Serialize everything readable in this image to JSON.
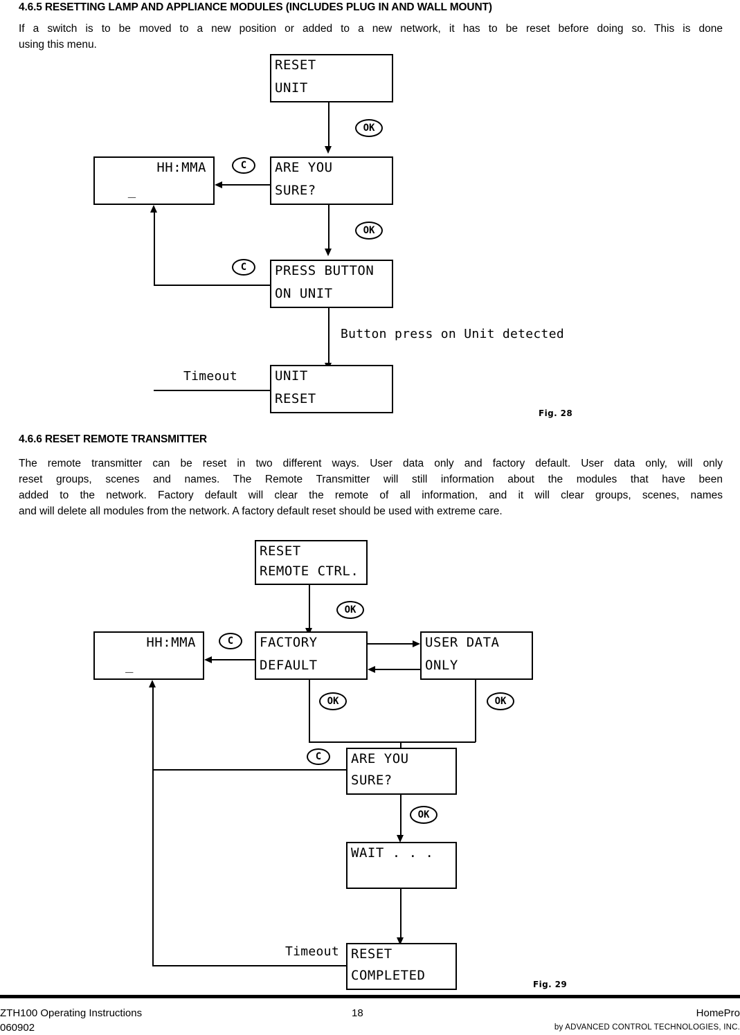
{
  "document": {
    "page_number": "18",
    "footer_left_line1": "ZTH100 Operating Instructions",
    "footer_left_line2": "060902",
    "footer_right_brand": "HomePro",
    "footer_right_sub": "by ADVANCED CONTROL TECHNOLOGIES, INC."
  },
  "section_465": {
    "heading": "4.6.5 RESETTING LAMP AND APPLIANCE MODULES (INCLUDES PLUG IN AND WALL MOUNT)",
    "body_line1": "If a switch is to be moved to a new position or added to a new network, it has to be reset before doing so.  This is done",
    "body_line2": "using this menu."
  },
  "section_466": {
    "heading": "4.6.6  RESET  REMOTE  TRANSMITTER",
    "body_line1": "The remote transmitter can be reset in two different ways. User data only and factory default.  User data only, will only",
    "body_line2": "reset groups, scenes and names.  The Remote Transmitter will still information about the modules that have been",
    "body_line3": "added to the network.  Factory default will clear the remote of all information, and it will clear groups, scenes, names",
    "body_line4": "and will delete all modules from the network.  A factory default reset should be used with extreme care."
  },
  "figure_28": {
    "caption": "Fig. 28",
    "nodes": {
      "reset_unit": {
        "line1": "RESET",
        "line2": "UNIT"
      },
      "are_you_sure": {
        "line1": "ARE YOU",
        "line2": "SURE?"
      },
      "clock": {
        "line1": "HH:MMA",
        "line2": "_"
      },
      "press_button": {
        "line1": "PRESS BUTTON",
        "line2": "ON UNIT"
      },
      "unit_reset": {
        "line1": "UNIT",
        "line2": "RESET"
      }
    },
    "keys": {
      "ok_1": "OK",
      "ok_2": "OK",
      "c_1": "C",
      "c_2": "C"
    },
    "edge_labels": {
      "button_press": "Button press on Unit detected",
      "timeout": "Timeout"
    }
  },
  "figure_29": {
    "caption": "Fig. 29",
    "nodes": {
      "reset_remote": {
        "line1": "RESET",
        "line2": "REMOTE CTRL."
      },
      "clock": {
        "line1": "HH:MMA",
        "line2": "_"
      },
      "factory_def": {
        "line1": "FACTORY",
        "line2": "DEFAULT"
      },
      "user_data": {
        "line1": "USER DATA",
        "line2": "ONLY"
      },
      "are_you_sure": {
        "line1": "ARE YOU",
        "line2": "SURE?"
      },
      "wait": {
        "line1": "WAIT . . .",
        "line2": ""
      },
      "reset_done": {
        "line1": "RESET",
        "line2": "COMPLETED"
      }
    },
    "keys": {
      "ok_1": "OK",
      "ok_2": "OK",
      "ok_3": "OK",
      "ok_4": "OK",
      "c_1": "C",
      "c_2": "C"
    },
    "edge_labels": {
      "timeout": "Timeout"
    }
  }
}
